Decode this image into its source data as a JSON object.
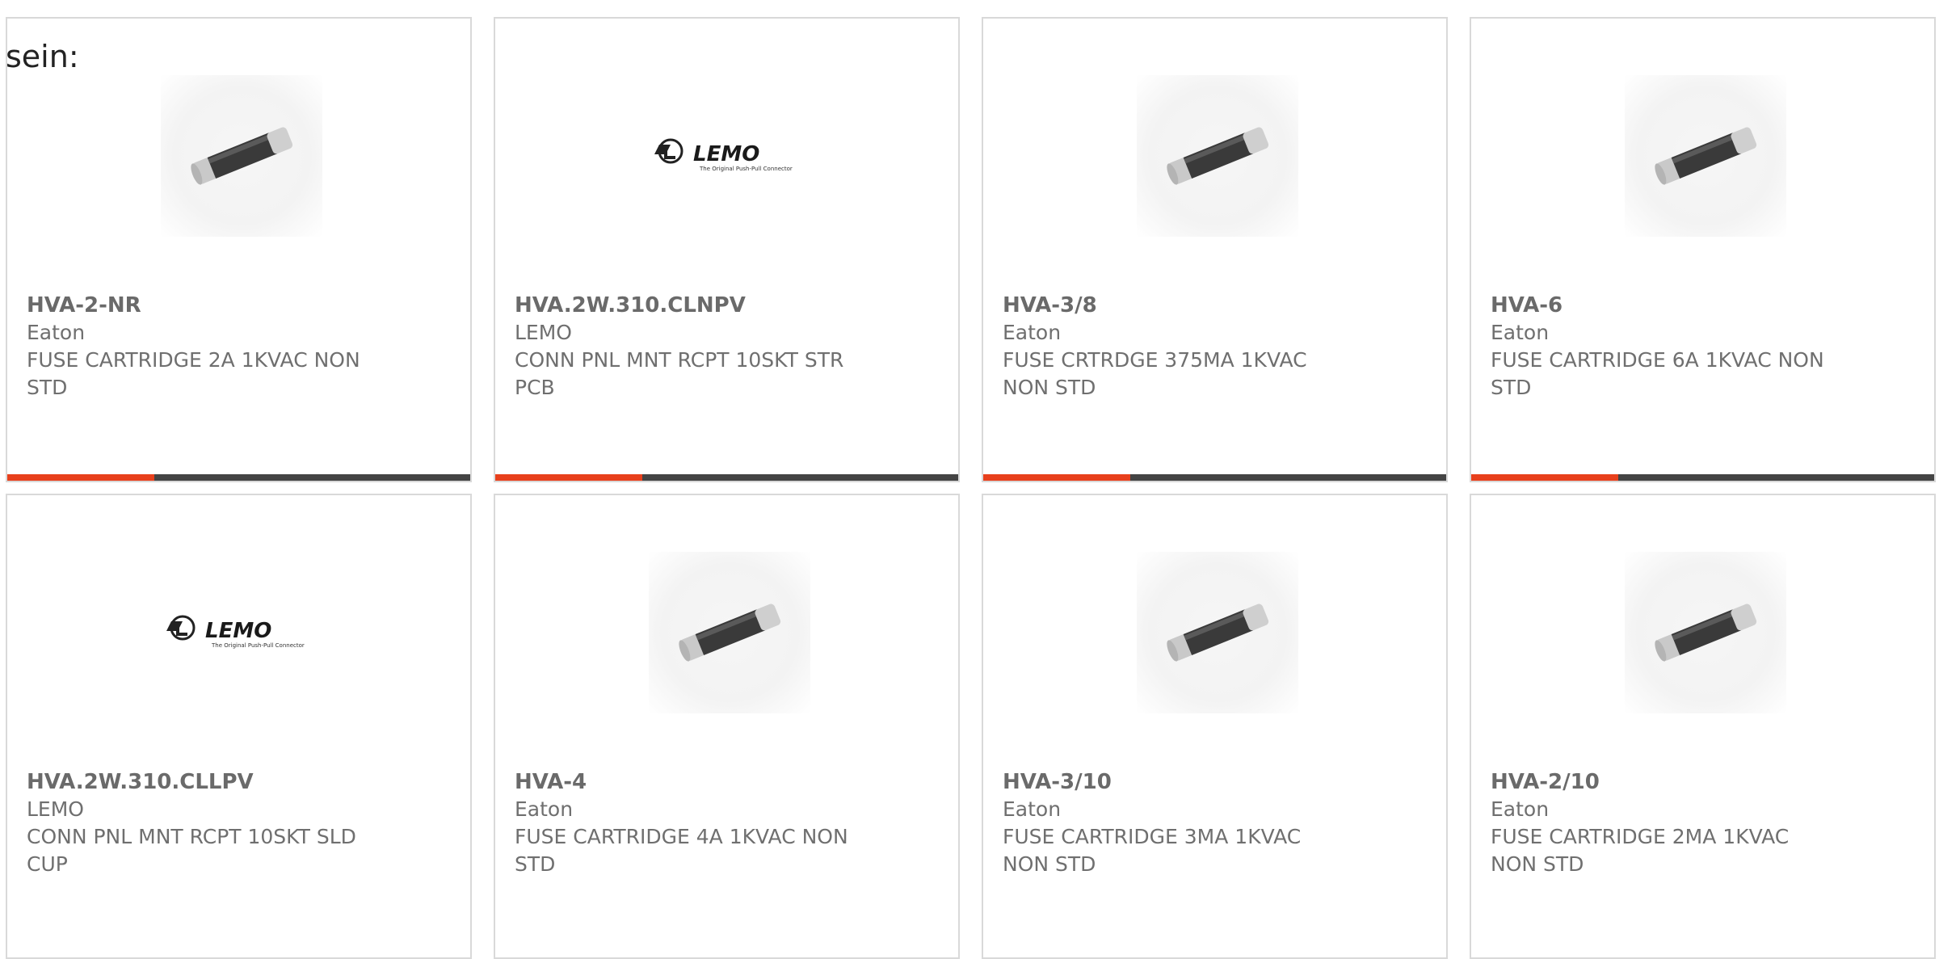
{
  "intro_text": "sein:",
  "colors": {
    "accent": "#e8401c",
    "bar": "#444444",
    "text": "#6f6f6f",
    "border": "#d9d9d9"
  },
  "products": [
    {
      "part_number": "HVA-2-NR",
      "brand": "Eaton",
      "desc_line1": "FUSE CARTRIDGE 2A 1KVAC NON",
      "desc_line2": "STD",
      "image": "fuse-cartridge-icon"
    },
    {
      "part_number": "HVA.2W.310.CLNPV",
      "brand": "LEMO",
      "desc_line1": "CONN PNL MNT RCPT 10SKT STR",
      "desc_line2": "PCB",
      "image": "lemo-logo",
      "logo_text": "LEMO",
      "logo_tagline": "The Original Push-Pull Connector"
    },
    {
      "part_number": "HVA-3/8",
      "brand": "Eaton",
      "desc_line1": "FUSE CRTRDGE 375MA 1KVAC",
      "desc_line2": "NON STD",
      "image": "fuse-cartridge-icon"
    },
    {
      "part_number": "HVA-6",
      "brand": "Eaton",
      "desc_line1": "FUSE CARTRIDGE 6A 1KVAC NON",
      "desc_line2": "STD",
      "image": "fuse-cartridge-icon"
    },
    {
      "part_number": "HVA.2W.310.CLLPV",
      "brand": "LEMO",
      "desc_line1": "CONN PNL MNT RCPT 10SKT SLD",
      "desc_line2": "CUP",
      "image": "lemo-logo",
      "logo_text": "LEMO",
      "logo_tagline": "The Original Push-Pull Connector"
    },
    {
      "part_number": "HVA-4",
      "brand": "Eaton",
      "desc_line1": "FUSE CARTRIDGE 4A 1KVAC NON",
      "desc_line2": "STD",
      "image": "fuse-cartridge-icon"
    },
    {
      "part_number": "HVA-3/10",
      "brand": "Eaton",
      "desc_line1": "FUSE CARTRIDGE 3MA 1KVAC",
      "desc_line2": "NON STD",
      "image": "fuse-cartridge-icon"
    },
    {
      "part_number": "HVA-2/10",
      "brand": "Eaton",
      "desc_line1": "FUSE CARTRIDGE 2MA 1KVAC",
      "desc_line2": "NON STD",
      "image": "fuse-cartridge-icon"
    }
  ]
}
